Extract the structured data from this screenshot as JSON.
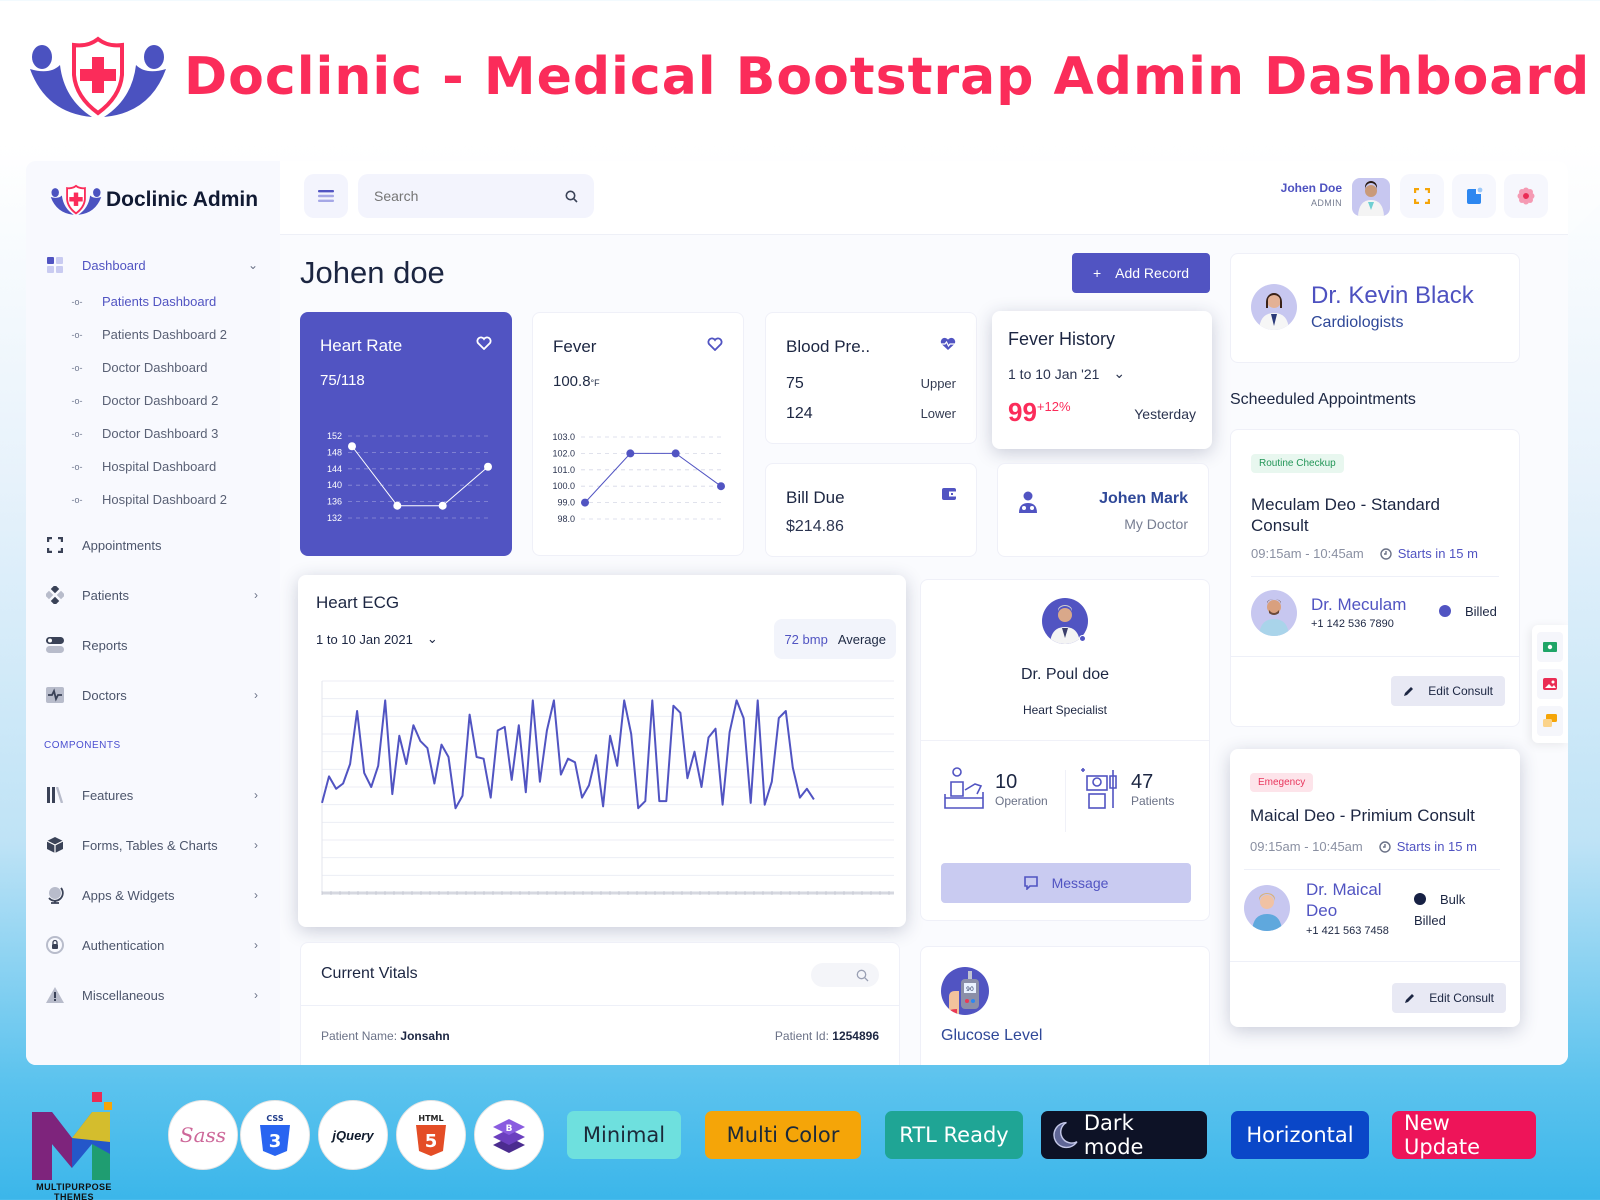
{
  "banner": {
    "title": "Doclinic - Medical Bootstrap Admin Dashboard"
  },
  "sidebar": {
    "brand": "Doclinic Admin",
    "dashboard": {
      "label": "Dashboard",
      "sub_items": [
        {
          "label": "Patients Dashboard",
          "active": true
        },
        {
          "label": "Patients Dashboard 2"
        },
        {
          "label": "Doctor Dashboard"
        },
        {
          "label": "Doctor Dashboard 2"
        },
        {
          "label": "Doctor Dashboard 3"
        },
        {
          "label": "Hospital Dashboard"
        },
        {
          "label": "Hospital Dashboard 2"
        }
      ]
    },
    "items": [
      {
        "label": "Appointments",
        "icon": "appointments-icon"
      },
      {
        "label": "Patients",
        "icon": "patients-icon",
        "has_children": true
      },
      {
        "label": "Reports",
        "icon": "reports-icon"
      },
      {
        "label": "Doctors",
        "icon": "doctors-icon",
        "has_children": true
      }
    ],
    "section_label": "COMPONENTS",
    "component_items": [
      {
        "label": "Features",
        "icon": "features-icon",
        "has_children": true
      },
      {
        "label": "Forms, Tables & Charts",
        "icon": "box-icon",
        "has_children": true
      },
      {
        "label": "Apps & Widgets",
        "icon": "globe-icon",
        "has_children": true
      },
      {
        "label": "Authentication",
        "icon": "lock-icon",
        "has_children": true
      },
      {
        "label": "Miscellaneous",
        "icon": "warning-icon",
        "has_children": true
      }
    ]
  },
  "topbar": {
    "search_placeholder": "Search",
    "user_name": "Johen Doe",
    "user_role": "ADMIN"
  },
  "page": {
    "title": "Johen doe",
    "add_button": "Add Record",
    "add_icon": "+"
  },
  "heart_rate": {
    "title": "Heart Rate",
    "value": "75/118"
  },
  "fever": {
    "title": "Fever",
    "value": "100.8",
    "unit": "°F"
  },
  "blood_pressure": {
    "title": "Blood Pre..",
    "upper_value": "75",
    "upper_label": "Upper",
    "lower_value": "124",
    "lower_label": "Lower"
  },
  "bill_due": {
    "title": "Bill Due",
    "amount": "$214.86"
  },
  "fever_history": {
    "title": "Fever History",
    "range": "1 to 10 Jan '21",
    "value": "99",
    "change": "+12%",
    "period": "Yesterday"
  },
  "my_doctor": {
    "name": "Johen Mark",
    "label": "My Doctor"
  },
  "ecg": {
    "title": "Heart ECG",
    "range": "1 to 10 Jan 2021",
    "avg_value": "72 bmp",
    "avg_label": "Average"
  },
  "doctor_card": {
    "name": "Dr. Poul doe",
    "specialty": "Heart Specialist",
    "operations_value": "10",
    "operations_label": "Operation",
    "patients_value": "47",
    "patients_label": "Patients",
    "message_button": "Message"
  },
  "current_vitals": {
    "title": "Current Vitals",
    "patient_name_label": "Patient Name:",
    "patient_name": "Jonsahn",
    "patient_id_label": "Patient Id:",
    "patient_id": "1254896"
  },
  "glucose": {
    "title": "Glucose Level"
  },
  "featured_doctor": {
    "name": "Dr. Kevin Black",
    "specialty": "Cardiologists"
  },
  "scheduled": {
    "title": "Scheeduled Appointments",
    "appointments": [
      {
        "tag": "Routine Checkup",
        "title": "Meculam Deo - Standard Consult",
        "time": "09:15am - 10:45am",
        "starts": "Starts in 15 m",
        "doctor": "Dr. Meculam",
        "phone": "+1 142 536 7890",
        "billing": "Billed",
        "billing_color": "#5154c2",
        "edit_button": "Edit Consult"
      },
      {
        "tag": "Emegency",
        "title": "Maical Deo - Primium Consult",
        "time": "09:15am - 10:45am",
        "starts": "Starts in 15 m",
        "doctor": "Dr. Maical Deo",
        "phone": "+1 421 563 7458",
        "billing": "Bulk Billed",
        "billing_color": "#172144",
        "edit_button": "Edit Consult"
      }
    ]
  },
  "footer": {
    "brand_label": "MULTIPURPOSE THEMES",
    "tech_badges": [
      "Sass",
      "CSS3",
      "jQuery",
      "HTML5",
      "Bootstrap"
    ],
    "pills": [
      {
        "label": "Minimal",
        "bg": "#6ee0de",
        "fg": "#1c2a3a"
      },
      {
        "label": "Multi Color",
        "bg": "#f5a508",
        "fg": "#1c2a3a"
      },
      {
        "label": "RTL Ready",
        "bg": "#1fa595",
        "fg": "#ffffff"
      },
      {
        "label": "Dark mode",
        "bg": "#0d1226",
        "fg": "#ffffff"
      },
      {
        "label": "Horizontal",
        "bg": "#0a47c8",
        "fg": "#ffffff"
      },
      {
        "label": "New Update",
        "bg": "#ee1459",
        "fg": "#ffffff"
      }
    ]
  },
  "colors": {
    "primary": "#5154c2",
    "accent_red": "#fb2c5a",
    "text_dark": "#1c2642"
  },
  "chart_data": [
    {
      "type": "line",
      "title": "Heart Rate",
      "x": [
        1,
        2,
        3,
        4
      ],
      "values": [
        149.5,
        135,
        135,
        144.5
      ],
      "yticks": [
        132,
        136,
        140,
        144,
        148,
        152
      ],
      "ylim": [
        132,
        152
      ],
      "grid": true
    },
    {
      "type": "line",
      "title": "Fever",
      "x": [
        1,
        2,
        3,
        4
      ],
      "values": [
        99.0,
        102.0,
        102.0,
        100.0
      ],
      "yticks": [
        "98.0",
        "99.0",
        "100.0",
        "101.0",
        "102.0",
        "103.0"
      ],
      "ylim": [
        98,
        103
      ],
      "grid": true
    },
    {
      "type": "line",
      "title": "Heart ECG",
      "ylim": [
        0,
        12
      ],
      "grid": true,
      "values": [
        5.1,
        6.6,
        5.9,
        6.2,
        7.3,
        10.3,
        6.8,
        6.0,
        7.2,
        10.9,
        5.6,
        8.9,
        7.3,
        9.5,
        8.6,
        8.2,
        6.2,
        8.4,
        7.7,
        4.8,
        5.5,
        10.1,
        7.7,
        7.6,
        5.4,
        9.2,
        9.4,
        6.4,
        9.5,
        5.7,
        10.9,
        6.3,
        9.2,
        10.9,
        6.7,
        7.6,
        7.4,
        5.4,
        6.1,
        7.8,
        4.9,
        8.9,
        7.2,
        10.9,
        9.0,
        4.8,
        5.2,
        10.9,
        5.2,
        5.2,
        10.6,
        10.2,
        6.5,
        8.0,
        6.0,
        8.8,
        9.3,
        5.0,
        9.1,
        10.9,
        9.9,
        5.1,
        10.9,
        5.0,
        6.3,
        9.9,
        10.3,
        7.1,
        5.4,
        5.9,
        5.3
      ],
      "xlabel": "",
      "ylabel": ""
    }
  ]
}
